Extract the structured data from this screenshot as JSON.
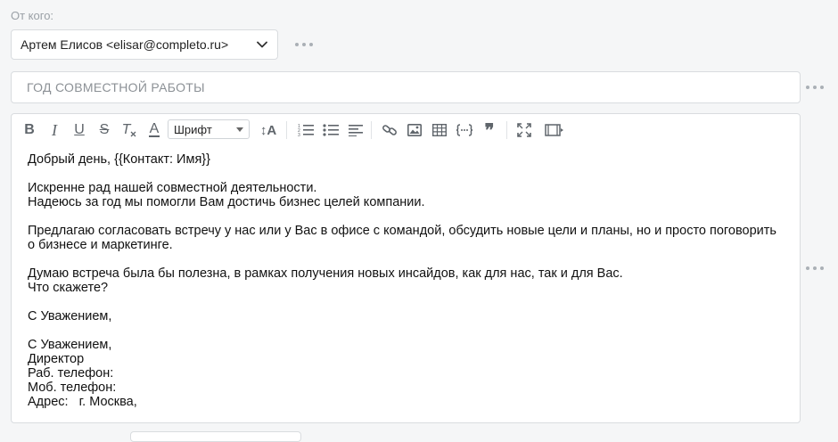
{
  "from": {
    "label": "От кого:",
    "value": "Артем Елисов <elisar@completo.ru>"
  },
  "subject": {
    "value": "ГОД СОВМЕСТНОЙ РАБОТЫ"
  },
  "toolbar": {
    "bold": "B",
    "italic": "I",
    "underline": "U",
    "strike": "S",
    "clear_format": "T",
    "font_color": "A",
    "font_select": "Шрифт",
    "font_size": "↕A",
    "quote": "❞"
  },
  "body": {
    "lines": [
      "Добрый день, {{Контакт: Имя}}",
      "",
      "Искренне рад нашей совместной деятельности.",
      "Надеюсь за год мы помогли Вам достичь бизнес целей компании.",
      "",
      "Предлагаю согласовать встречу у нас или у Вас в офисе с командой, обсудить новые цели и планы, но и просто поговорить",
      "о бизнесе и маркетинге.",
      "",
      "Думаю встреча была бы полезна, в рамках получения новых инсайдов, как для нас, так и для Вас.",
      "Что скажете?",
      "",
      "С Уважением,",
      "",
      "С Уважением,",
      "Директор",
      "Раб. телефон:",
      "Моб. телефон:",
      "Адрес:   г. Москва,"
    ]
  }
}
